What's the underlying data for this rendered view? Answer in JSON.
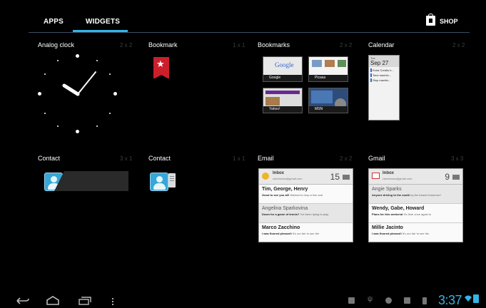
{
  "tabs": [
    {
      "label": "APPS",
      "selected": false
    },
    {
      "label": "WIDGETS",
      "selected": true
    }
  ],
  "shop": {
    "label": "SHOP",
    "icon": "shop-bag-icon"
  },
  "colors": {
    "accent": "#33b5e5",
    "bookmark_red": "#cc1f2b",
    "contact_blue": "#35a7d8"
  },
  "widgets": [
    {
      "title": "Analog clock",
      "size": "2 x 2"
    },
    {
      "title": "Bookmark",
      "size": "1 x 1"
    },
    {
      "title": "Bookmarks",
      "size": "2 x 2"
    },
    {
      "title": "Calendar",
      "size": "2 x 2"
    },
    {
      "title": "Contact",
      "size": "3 x 1"
    },
    {
      "title": "Contact",
      "size": "1 x 1"
    },
    {
      "title": "Email",
      "size": "2 x 2"
    },
    {
      "title": "Gmail",
      "size": "3 x 3"
    }
  ],
  "bookmarks": {
    "thumbs": [
      {
        "caption": "Google",
        "logo": "Google"
      },
      {
        "caption": "Picasa"
      },
      {
        "caption": "Yahoo!"
      },
      {
        "caption": "MSN"
      }
    ]
  },
  "calendar": {
    "day": "Tue",
    "date": "Sep 27",
    "events": [
      "Extra Credits b...",
      "Time machin...",
      "Stop machin..."
    ]
  },
  "email": {
    "inbox": "Inbox",
    "account": "careknowz@gmail.com",
    "count": "15",
    "messages": [
      {
        "from": "Tim, George, Henry",
        "subject": "Good to see you all!",
        "snippet": "Wanted to drop a line and",
        "read": false
      },
      {
        "from": "Angelina Sparkovina",
        "subject": "Down for a game of tennis?",
        "snippet": "I've been dying to play",
        "read": true
      },
      {
        "from": "Marco Zacchino",
        "subject": "I was floored pleased!",
        "snippet": "It's our fair to see the",
        "read": false
      }
    ]
  },
  "gmail": {
    "inbox": "Inbox",
    "account": "careknowz@gmail.com",
    "count": "9",
    "messages": [
      {
        "from": "Angie Sparks",
        "subject": "Anyone driving to the south",
        "snippet": "by the beach tomorrow?",
        "read": true
      },
      {
        "from": "Wendy, Gabe, Howard",
        "subject": "Plans for this weekend",
        "snippet": "It's time once again to",
        "read": false
      },
      {
        "from": "Millie Jacinto",
        "subject": "I was floored pleased!",
        "snippet": "It's our fair to see the",
        "read": false
      }
    ]
  },
  "status": {
    "time": "3:37"
  },
  "navigation": {
    "back": "back-icon",
    "home": "home-icon",
    "recents": "recent-apps-icon",
    "menu": "menu-icon"
  }
}
